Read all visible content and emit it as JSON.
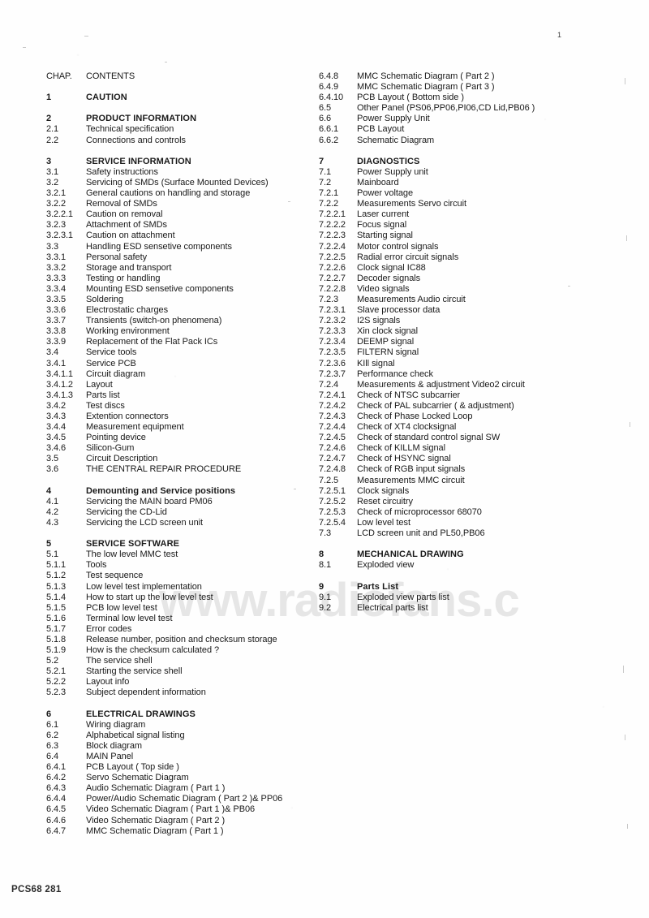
{
  "document": {
    "page_number": "1",
    "footer": "PCS68 281",
    "watermark": "www.radiofans.c"
  },
  "header": {
    "chapter_label": "CHAP.",
    "contents_label": "CONTENTS"
  },
  "left_column": [
    {
      "num": "CHAP.",
      "text": "CONTENTS",
      "style": "head"
    },
    {
      "num": "",
      "text": "",
      "style": "spacer"
    },
    {
      "num": "1",
      "text": "CAUTION",
      "style": "bold"
    },
    {
      "num": "",
      "text": "",
      "style": "spacer"
    },
    {
      "num": "2",
      "text": "PRODUCT INFORMATION",
      "style": "bold"
    },
    {
      "num": "2.1",
      "text": "Technical   specification",
      "style": "normal"
    },
    {
      "num": "2.2",
      "text": "Connections  and  controls",
      "style": "normal"
    },
    {
      "num": "",
      "text": "",
      "style": "spacer"
    },
    {
      "num": "3",
      "text": "SERVICE INFORMATION",
      "style": "bold"
    },
    {
      "num": "3.1",
      "text": "Safety   instructions",
      "style": "normal"
    },
    {
      "num": "3.2",
      "text": "Servicing of SMDs (Surface Mounted Devices)",
      "style": "normal"
    },
    {
      "num": "3.2.1",
      "text": "General cautions on handling and storage",
      "style": "normal"
    },
    {
      "num": "3.2.2",
      "text": "Removal of SMDs",
      "style": "normal"
    },
    {
      "num": "3.2.2.1",
      "text": "Caution on removal",
      "style": "normal"
    },
    {
      "num": "3.2.3",
      "text": "Attachment of SMDs",
      "style": "normal"
    },
    {
      "num": "3.2.3.1",
      "text": "Caution on attachment",
      "style": "normal"
    },
    {
      "num": "3.3",
      "text": "Handling ESD sensetive components",
      "style": "normal"
    },
    {
      "num": "3.3.1",
      "text": "Personal  safety",
      "style": "normal"
    },
    {
      "num": "3.3.2",
      "text": "Storage  and  transport",
      "style": "normal"
    },
    {
      "num": "3.3.3",
      "text": "Testing  or  handling",
      "style": "normal"
    },
    {
      "num": "3.3.4",
      "text": "Mounting ESD sensetive components",
      "style": "normal"
    },
    {
      "num": "3.3.5",
      "text": "Soldering",
      "style": "normal"
    },
    {
      "num": "3.3.6",
      "text": "Electrostatic   charges",
      "style": "normal"
    },
    {
      "num": "3.3.7",
      "text": "Transients  (switch-on  phenomena)",
      "style": "normal"
    },
    {
      "num": "3.3.8",
      "text": "Working  environment",
      "style": "normal"
    },
    {
      "num": "3.3.9",
      "text": "Replacement of the Flat Pack ICs",
      "style": "normal"
    },
    {
      "num": "3.4",
      "text": "Service  tools",
      "style": "normal"
    },
    {
      "num": "3.4.1",
      "text": "Service PCB",
      "style": "normal"
    },
    {
      "num": "3.4.1.1",
      "text": "Circuit  diagram",
      "style": "normal"
    },
    {
      "num": "3.4.1.2",
      "text": "Layout",
      "style": "normal"
    },
    {
      "num": "3.4.1.3",
      "text": "Parts  list",
      "style": "normal"
    },
    {
      "num": "3.4.2",
      "text": "Test  discs",
      "style": "normal"
    },
    {
      "num": "3.4.3",
      "text": "Extention   connectors",
      "style": "normal"
    },
    {
      "num": "3.4.4",
      "text": "Measurement  equipment",
      "style": "normal"
    },
    {
      "num": "3.4.5",
      "text": "Pointing  device",
      "style": "normal"
    },
    {
      "num": "3.4.6",
      "text": "Silicon-Gum",
      "style": "normal"
    },
    {
      "num": "3.5",
      "text": "Circuit  Description",
      "style": "normal"
    },
    {
      "num": "3.6",
      "text": "THE CENTRAL REPAIR PROCEDURE",
      "style": "normal"
    },
    {
      "num": "",
      "text": "",
      "style": "spacer"
    },
    {
      "num": "4",
      "text": "Demounting and Service positions",
      "style": "bold"
    },
    {
      "num": "4.1",
      "text": "Servicing the MAIN board PM06",
      "style": "normal"
    },
    {
      "num": "4.2",
      "text": "Servicing the CD-Lid",
      "style": "normal"
    },
    {
      "num": "4.3",
      "text": "Servicing the LCD screen unit",
      "style": "normal"
    },
    {
      "num": "",
      "text": "",
      "style": "spacer"
    },
    {
      "num": "5",
      "text": "SERVICE SOFTWARE",
      "style": "bold"
    },
    {
      "num": "5.1",
      "text": "The low level MMC test",
      "style": "normal"
    },
    {
      "num": "5.1.1",
      "text": "Tools",
      "style": "normal"
    },
    {
      "num": "5.1.2",
      "text": "Test  sequence",
      "style": "normal"
    },
    {
      "num": "5.1.3",
      "text": "Low level test implementation",
      "style": "normal"
    },
    {
      "num": "5.1.4",
      "text": "How to start up the low level test",
      "style": "normal"
    },
    {
      "num": "5.1.5",
      "text": "PCB low level test",
      "style": "normal"
    },
    {
      "num": "5.1.6",
      "text": "Terminal low level test",
      "style": "normal"
    },
    {
      "num": "5.1.7",
      "text": "Error  codes",
      "style": "normal"
    },
    {
      "num": "5.1.8",
      "text": "Release number, position and checksum storage",
      "style": "normal"
    },
    {
      "num": "5.1.9",
      "text": "How is the checksum calculated ?",
      "style": "normal"
    },
    {
      "num": "5.2",
      "text": "The service shell",
      "style": "normal"
    },
    {
      "num": "5.2.1",
      "text": "Starting the service shell",
      "style": "normal"
    },
    {
      "num": "5.2.2",
      "text": "Layout  info",
      "style": "normal"
    },
    {
      "num": "5.2.3",
      "text": "Subject  dependent  information",
      "style": "normal"
    },
    {
      "num": "",
      "text": "",
      "style": "spacer"
    },
    {
      "num": "6",
      "text": "ELECTRICAL DRAWINGS",
      "style": "bold"
    },
    {
      "num": "6.1",
      "text": "Wiring diagram",
      "style": "normal"
    },
    {
      "num": "6.2",
      "text": "Alphabetical  signal  listing",
      "style": "normal"
    },
    {
      "num": "6.3",
      "text": "Block  diagram",
      "style": "normal"
    },
    {
      "num": "6.4",
      "text": "MAIN Panel",
      "style": "normal"
    },
    {
      "num": "6.4.1",
      "text": "PCB Layout ( Top side )",
      "style": "normal"
    },
    {
      "num": "6.4.2",
      "text": "Servo  Schematic  Diagram",
      "style": "normal"
    },
    {
      "num": "6.4.3",
      "text": "Audio Schematic Diagram ( Part 1 )",
      "style": "normal"
    },
    {
      "num": "6.4.4",
      "text": "Power/Audio Schematic Diagram ( Part 2 )& PP06",
      "style": "normal"
    },
    {
      "num": "6.4.5",
      "text": "Video Schematic Diagram ( Part 1 )& PB06",
      "style": "normal"
    },
    {
      "num": "6.4.6",
      "text": "Video Schematic Diagram ( Part 2 )",
      "style": "normal"
    },
    {
      "num": "6.4.7",
      "text": "MMC Schematic Diagram ( Part 1 )",
      "style": "normal"
    }
  ],
  "right_column": [
    {
      "num": "6.4.8",
      "text": "MMC Schematic Diagram ( Part 2 )",
      "style": "normal"
    },
    {
      "num": "6.4.9",
      "text": "MMC Schematic Diagram ( Part 3 )",
      "style": "normal"
    },
    {
      "num": "6.4.10",
      "text": "PCB Layout ( Bottom side )",
      "style": "normal"
    },
    {
      "num": "6.5",
      "text": "Other Panel (PS06,PP06,PI06,CD Lid,PB06 )",
      "style": "normal"
    },
    {
      "num": "6.6",
      "text": "Power Supply Unit",
      "style": "normal"
    },
    {
      "num": "6.6.1",
      "text": "PCB Layout",
      "style": "normal"
    },
    {
      "num": "6.6.2",
      "text": "Schematic Diagram",
      "style": "normal"
    },
    {
      "num": "",
      "text": "",
      "style": "spacer"
    },
    {
      "num": "7",
      "text": "DIAGNOSTICS",
      "style": "bold"
    },
    {
      "num": "7.1",
      "text": "Power Supply unit",
      "style": "normal"
    },
    {
      "num": "7.2",
      "text": "Mainboard",
      "style": "normal"
    },
    {
      "num": "7.2.1",
      "text": "Power  voltage",
      "style": "normal"
    },
    {
      "num": "7.2.2",
      "text": "Measurements  Servo  circuit",
      "style": "normal"
    },
    {
      "num": "7.2.2.1",
      "text": "Laser  current",
      "style": "normal"
    },
    {
      "num": "7.2.2.2",
      "text": "Focus  signal",
      "style": "normal"
    },
    {
      "num": "7.2.2.3",
      "text": "Starting  signal",
      "style": "normal"
    },
    {
      "num": "7.2.2.4",
      "text": "Motor  control  signals",
      "style": "normal"
    },
    {
      "num": "7.2.2.5",
      "text": "Radial error circuit signals",
      "style": "normal"
    },
    {
      "num": "7.2.2.6",
      "text": "Clock signal IC88",
      "style": "normal"
    },
    {
      "num": "7.2.2.7",
      "text": "Decoder  signals",
      "style": "normal"
    },
    {
      "num": "7.2.2.8",
      "text": "Video  signals",
      "style": "normal"
    },
    {
      "num": "7.2.3",
      "text": "Measurements  Audio  circuit",
      "style": "normal"
    },
    {
      "num": "7.2.3.1",
      "text": "Slave  processor  data",
      "style": "normal"
    },
    {
      "num": "7.2.3.2",
      "text": "I2S  signals",
      "style": "normal"
    },
    {
      "num": "7.2.3.3",
      "text": "Xin clock signal",
      "style": "normal"
    },
    {
      "num": "7.2.3.4",
      "text": "DEEMP signal",
      "style": "normal"
    },
    {
      "num": "7.2.3.5",
      "text": "FILTERN signal",
      "style": "normal"
    },
    {
      "num": "7.2.3.6",
      "text": "KIll signal",
      "style": "normal"
    },
    {
      "num": "7.2.3.7",
      "text": "Performance  check",
      "style": "normal"
    },
    {
      "num": "7.2.4",
      "text": "Measurements & adjustment Video2 circuit",
      "style": "normal"
    },
    {
      "num": "7.2.4.1",
      "text": "Check of NTSC subcarrier",
      "style": "normal"
    },
    {
      "num": "7.2.4.2",
      "text": "Check of PAL subcarrier ( & adjustment)",
      "style": "normal"
    },
    {
      "num": "7.2.4.3",
      "text": "Check of Phase Locked Loop",
      "style": "normal"
    },
    {
      "num": "7.2.4.4",
      "text": "Check of XT4 clocksignal",
      "style": "normal"
    },
    {
      "num": "7.2.4.5",
      "text": "Check of standard control signal SW",
      "style": "normal"
    },
    {
      "num": "7.2.4.6",
      "text": "Check of KILLM signal",
      "style": "normal"
    },
    {
      "num": "7.2.4.7",
      "text": "Check of HSYNC signal",
      "style": "normal"
    },
    {
      "num": "7.2.4.8",
      "text": "Check of RGB input signals",
      "style": "normal"
    },
    {
      "num": "7.2.5",
      "text": "Measurements MMC circuit",
      "style": "normal"
    },
    {
      "num": "7.2.5.1",
      "text": "Clock  signals",
      "style": "normal"
    },
    {
      "num": "7.2.5.2",
      "text": "Reset  circuitry",
      "style": "normal"
    },
    {
      "num": "7.2.5.3",
      "text": "Check of microprocessor 68070",
      "style": "normal"
    },
    {
      "num": "7.2.5.4",
      "text": "Low level test",
      "style": "normal"
    },
    {
      "num": "7.3",
      "text": "LCD screen unit and PL50,PB06",
      "style": "normal"
    },
    {
      "num": "",
      "text": "",
      "style": "spacer"
    },
    {
      "num": "8",
      "text": "MECHANICAL DRAWING",
      "style": "bold"
    },
    {
      "num": "8.1",
      "text": "Exploded view",
      "style": "normal"
    },
    {
      "num": "",
      "text": "",
      "style": "spacer"
    },
    {
      "num": "9",
      "text": "Parts List",
      "style": "bold"
    },
    {
      "num": "9.1",
      "text": "Exploded view parts list",
      "style": "normal"
    },
    {
      "num": "9.2",
      "text": "Electrical  parts  list",
      "style": "normal"
    }
  ]
}
